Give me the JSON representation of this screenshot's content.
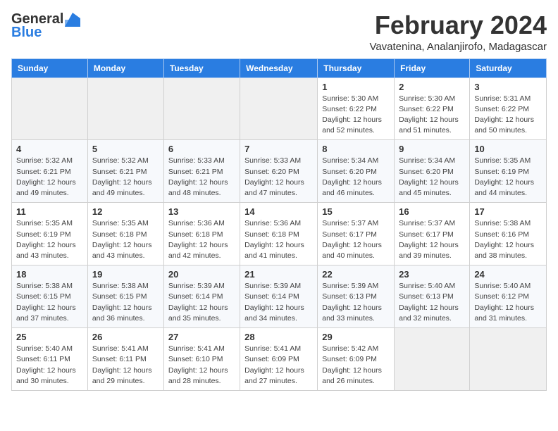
{
  "logo": {
    "general": "General",
    "blue": "Blue"
  },
  "title": "February 2024",
  "location": "Vavatenina, Analanjirofo, Madagascar",
  "days_of_week": [
    "Sunday",
    "Monday",
    "Tuesday",
    "Wednesday",
    "Thursday",
    "Friday",
    "Saturday"
  ],
  "weeks": [
    [
      {
        "day": "",
        "detail": ""
      },
      {
        "day": "",
        "detail": ""
      },
      {
        "day": "",
        "detail": ""
      },
      {
        "day": "",
        "detail": ""
      },
      {
        "day": "1",
        "detail": "Sunrise: 5:30 AM\nSunset: 6:22 PM\nDaylight: 12 hours\nand 52 minutes."
      },
      {
        "day": "2",
        "detail": "Sunrise: 5:30 AM\nSunset: 6:22 PM\nDaylight: 12 hours\nand 51 minutes."
      },
      {
        "day": "3",
        "detail": "Sunrise: 5:31 AM\nSunset: 6:22 PM\nDaylight: 12 hours\nand 50 minutes."
      }
    ],
    [
      {
        "day": "4",
        "detail": "Sunrise: 5:32 AM\nSunset: 6:21 PM\nDaylight: 12 hours\nand 49 minutes."
      },
      {
        "day": "5",
        "detail": "Sunrise: 5:32 AM\nSunset: 6:21 PM\nDaylight: 12 hours\nand 49 minutes."
      },
      {
        "day": "6",
        "detail": "Sunrise: 5:33 AM\nSunset: 6:21 PM\nDaylight: 12 hours\nand 48 minutes."
      },
      {
        "day": "7",
        "detail": "Sunrise: 5:33 AM\nSunset: 6:20 PM\nDaylight: 12 hours\nand 47 minutes."
      },
      {
        "day": "8",
        "detail": "Sunrise: 5:34 AM\nSunset: 6:20 PM\nDaylight: 12 hours\nand 46 minutes."
      },
      {
        "day": "9",
        "detail": "Sunrise: 5:34 AM\nSunset: 6:20 PM\nDaylight: 12 hours\nand 45 minutes."
      },
      {
        "day": "10",
        "detail": "Sunrise: 5:35 AM\nSunset: 6:19 PM\nDaylight: 12 hours\nand 44 minutes."
      }
    ],
    [
      {
        "day": "11",
        "detail": "Sunrise: 5:35 AM\nSunset: 6:19 PM\nDaylight: 12 hours\nand 43 minutes."
      },
      {
        "day": "12",
        "detail": "Sunrise: 5:35 AM\nSunset: 6:18 PM\nDaylight: 12 hours\nand 43 minutes."
      },
      {
        "day": "13",
        "detail": "Sunrise: 5:36 AM\nSunset: 6:18 PM\nDaylight: 12 hours\nand 42 minutes."
      },
      {
        "day": "14",
        "detail": "Sunrise: 5:36 AM\nSunset: 6:18 PM\nDaylight: 12 hours\nand 41 minutes."
      },
      {
        "day": "15",
        "detail": "Sunrise: 5:37 AM\nSunset: 6:17 PM\nDaylight: 12 hours\nand 40 minutes."
      },
      {
        "day": "16",
        "detail": "Sunrise: 5:37 AM\nSunset: 6:17 PM\nDaylight: 12 hours\nand 39 minutes."
      },
      {
        "day": "17",
        "detail": "Sunrise: 5:38 AM\nSunset: 6:16 PM\nDaylight: 12 hours\nand 38 minutes."
      }
    ],
    [
      {
        "day": "18",
        "detail": "Sunrise: 5:38 AM\nSunset: 6:15 PM\nDaylight: 12 hours\nand 37 minutes."
      },
      {
        "day": "19",
        "detail": "Sunrise: 5:38 AM\nSunset: 6:15 PM\nDaylight: 12 hours\nand 36 minutes."
      },
      {
        "day": "20",
        "detail": "Sunrise: 5:39 AM\nSunset: 6:14 PM\nDaylight: 12 hours\nand 35 minutes."
      },
      {
        "day": "21",
        "detail": "Sunrise: 5:39 AM\nSunset: 6:14 PM\nDaylight: 12 hours\nand 34 minutes."
      },
      {
        "day": "22",
        "detail": "Sunrise: 5:39 AM\nSunset: 6:13 PM\nDaylight: 12 hours\nand 33 minutes."
      },
      {
        "day": "23",
        "detail": "Sunrise: 5:40 AM\nSunset: 6:13 PM\nDaylight: 12 hours\nand 32 minutes."
      },
      {
        "day": "24",
        "detail": "Sunrise: 5:40 AM\nSunset: 6:12 PM\nDaylight: 12 hours\nand 31 minutes."
      }
    ],
    [
      {
        "day": "25",
        "detail": "Sunrise: 5:40 AM\nSunset: 6:11 PM\nDaylight: 12 hours\nand 30 minutes."
      },
      {
        "day": "26",
        "detail": "Sunrise: 5:41 AM\nSunset: 6:11 PM\nDaylight: 12 hours\nand 29 minutes."
      },
      {
        "day": "27",
        "detail": "Sunrise: 5:41 AM\nSunset: 6:10 PM\nDaylight: 12 hours\nand 28 minutes."
      },
      {
        "day": "28",
        "detail": "Sunrise: 5:41 AM\nSunset: 6:09 PM\nDaylight: 12 hours\nand 27 minutes."
      },
      {
        "day": "29",
        "detail": "Sunrise: 5:42 AM\nSunset: 6:09 PM\nDaylight: 12 hours\nand 26 minutes."
      },
      {
        "day": "",
        "detail": ""
      },
      {
        "day": "",
        "detail": ""
      }
    ]
  ],
  "empty_first_days": 4,
  "empty_last_days": 2
}
